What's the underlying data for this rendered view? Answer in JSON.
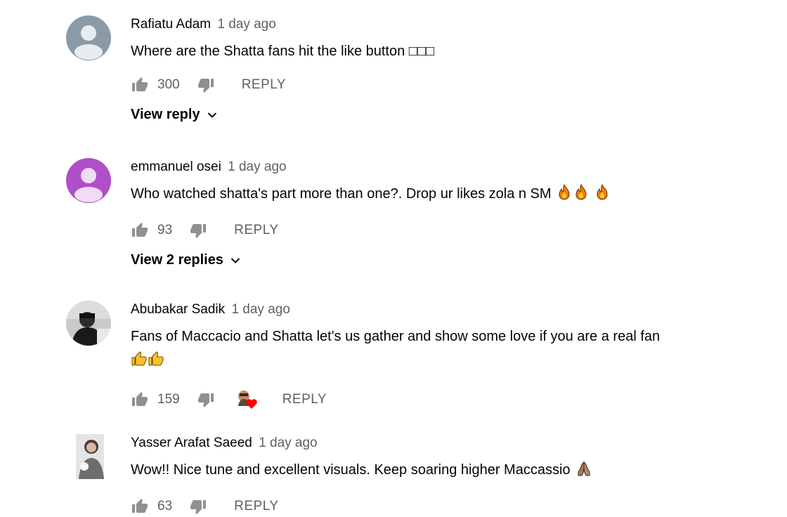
{
  "comments": [
    {
      "author": "Rafiatu Adam",
      "time": "1 day ago",
      "text": "Where are the Shatta fans hit the like button □□□",
      "likes": "300",
      "reply_label": "REPLY",
      "view_replies": "View reply",
      "avatar_color": "#8a9aa7"
    },
    {
      "author": "emmanuel osei",
      "time": "1 day ago",
      "text": "Who watched shatta's part more than one?. Drop ur likes zola n SM",
      "emojis": [
        "fire-icon",
        "fire-icon",
        "fire-icon"
      ],
      "likes": "93",
      "reply_label": "REPLY",
      "view_replies": "View 2 replies",
      "avatar_color": "#b04fc7"
    },
    {
      "author": "Abubakar Sadik",
      "time": "1 day ago",
      "text": "Fans of Maccacio and Shatta let's us gather and show some love if you are a real fan",
      "emojis": [
        "thumbs-up-emoji",
        "thumbs-up-emoji"
      ],
      "likes": "159",
      "reply_label": "REPLY",
      "hearted": true
    },
    {
      "author": "Yasser Arafat Saeed",
      "time": "1 day ago",
      "text": "Wow!! Nice tune and excellent visuals. Keep soaring higher Maccassio",
      "emojis": [
        "praying-hands-emoji"
      ],
      "likes": "63",
      "reply_label": "REPLY"
    }
  ],
  "colors": {
    "meta_text": "#606060",
    "icon": "#909090",
    "heart": "#ff0000"
  }
}
